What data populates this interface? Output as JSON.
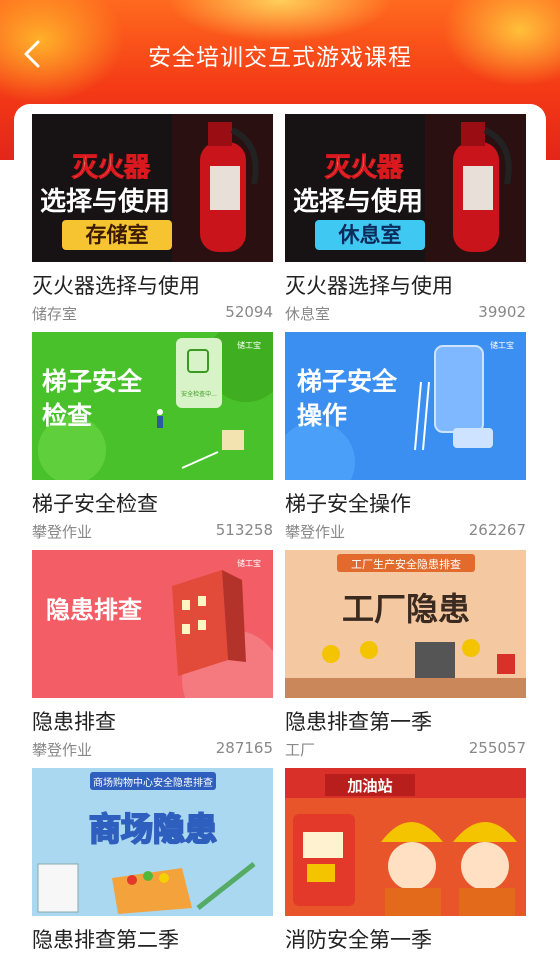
{
  "header": {
    "title": "安全培训交互式游戏课程",
    "back_icon": "chevron-left-icon"
  },
  "colors": {
    "header_red": "#f43a16",
    "header_orange": "#ff8a1e",
    "title_text": "#ffffff",
    "card_text": "#222222",
    "meta_text": "#888888"
  },
  "courses": [
    {
      "title": "灭火器选择与使用",
      "tag": "储存室",
      "count": "52094",
      "thumb": {
        "line1": "灭火器",
        "line2": "选择与使用",
        "badge": "存储室"
      }
    },
    {
      "title": "灭火器选择与使用",
      "tag": "休息室",
      "count": "39902",
      "thumb": {
        "line1": "灭火器",
        "line2": "选择与使用",
        "badge": "休息室"
      }
    },
    {
      "title": "梯子安全检查",
      "tag": "攀登作业",
      "count": "513258",
      "thumb": {
        "line1": "梯子安全",
        "line2": "检查",
        "logo": "储工宝",
        "phone_text": "安全检查中..."
      }
    },
    {
      "title": "梯子安全操作",
      "tag": "攀登作业",
      "count": "262267",
      "thumb": {
        "line1": "梯子安全",
        "line2": "操作",
        "logo": "储工宝"
      }
    },
    {
      "title": "隐患排查",
      "tag": "攀登作业",
      "count": "287165",
      "thumb": {
        "line1": "隐患排查",
        "logo": "储工宝"
      }
    },
    {
      "title": "隐患排查第一季",
      "tag": "工厂",
      "count": "255057",
      "thumb": {
        "banner": "工厂生产安全隐患排查",
        "line1": "工厂隐患"
      }
    },
    {
      "title": "隐患排查第二季",
      "tag": "",
      "count": "",
      "thumb": {
        "banner": "商场购物中心安全隐患排查",
        "line1": "商场隐患"
      }
    },
    {
      "title": "消防安全第一季",
      "tag": "",
      "count": "",
      "thumb": {
        "banner": "加油站"
      }
    }
  ]
}
